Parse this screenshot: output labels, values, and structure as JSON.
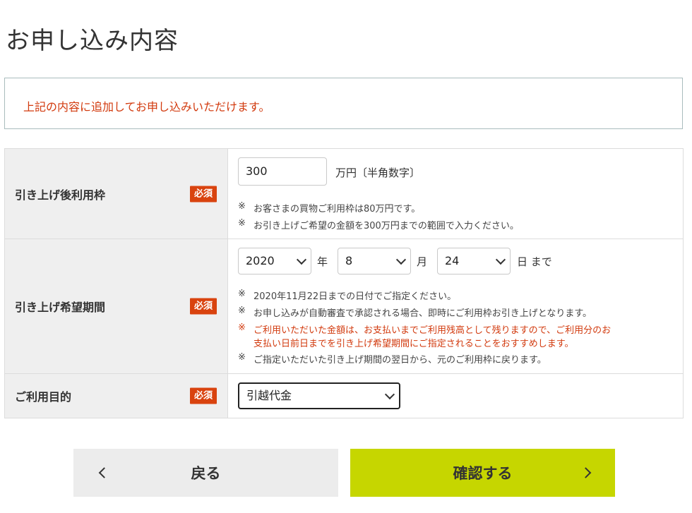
{
  "page": {
    "title": "お申し込み内容"
  },
  "notice": {
    "text": "上記の内容に追加してお申し込みいただけます。"
  },
  "required_label": "必須",
  "note_mark": "※",
  "limit_row": {
    "label": "引き上げ後利用枠",
    "input_value": "300",
    "unit": "万円〔半角数字〕",
    "notes": [
      "お客さまの買物ご利用枠は80万円です。",
      "お引き上げご希望の金額を300万円までの範囲で入力ください。"
    ]
  },
  "period_row": {
    "label": "引き上げ希望期間",
    "year": "2020",
    "year_unit": "年",
    "month": "8",
    "month_unit": "月",
    "day": "24",
    "day_unit": "日 まで",
    "notes": [
      "2020年11月22日までの日付でご指定ください。",
      "お申し込みが自動審査で承認される場合、即時にご利用枠お引き上げとなります。"
    ],
    "warning_line1": "ご利用いただいた金額は、お支払いまでご利用残高として残りますので、ご利用分のお",
    "warning_line2": "支払い日前日までを引き上げ希望期間にご指定されることをおすすめします。",
    "note_last": "ご指定いただいた引き上げ期間の翌日から、元のご利用枠に戻ります。"
  },
  "purpose_row": {
    "label": "ご利用目的",
    "selected": "引越代金"
  },
  "buttons": {
    "back": "戻る",
    "confirm": "確認する"
  },
  "colors": {
    "accent_red": "#d23a0e",
    "badge_red": "#d9430f",
    "confirm_green": "#c6d600"
  }
}
